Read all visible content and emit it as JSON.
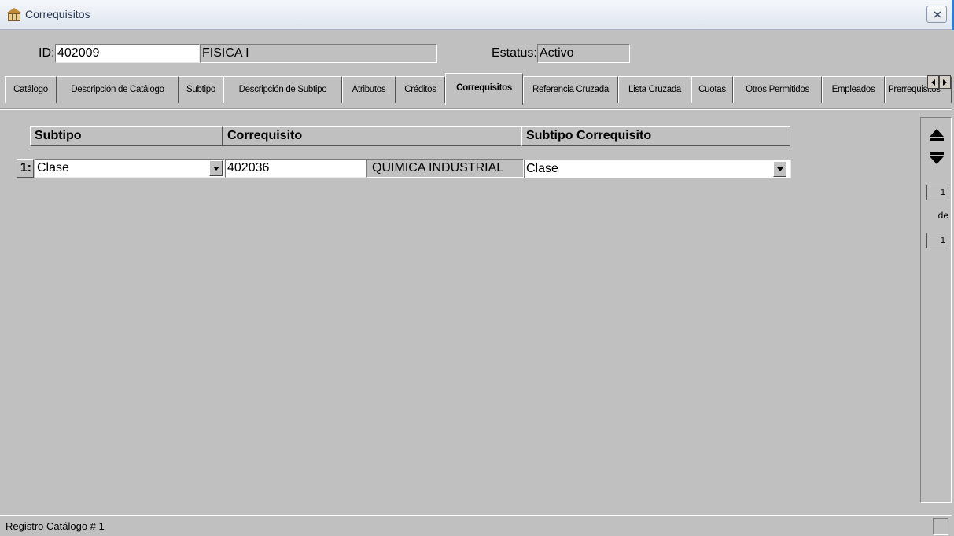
{
  "window": {
    "title": "Correquisitos",
    "colors": {
      "titlebar_text": "#2a3a55",
      "face": "#c0c0c0",
      "accent": "#2a7fd4"
    }
  },
  "header": {
    "id_label": "ID:",
    "id_value": "402009",
    "course_name": "FISICA I",
    "status_label": "Estatus:",
    "status_value": "Activo"
  },
  "tabs": [
    {
      "label": "Catálogo"
    },
    {
      "label": "Descripción de Catálogo"
    },
    {
      "label": "Subtipo"
    },
    {
      "label": "Descripción de Subtipo"
    },
    {
      "label": "Atributos"
    },
    {
      "label": "Créditos"
    },
    {
      "label": "Correquisitos"
    },
    {
      "label": "Referencia Cruzada"
    },
    {
      "label": "Lista Cruzada"
    },
    {
      "label": "Cuotas"
    },
    {
      "label": "Otros Permitidos"
    },
    {
      "label": "Empleados"
    },
    {
      "label": "Prerrequisitos"
    }
  ],
  "active_tab": "Correquisitos",
  "grid": {
    "headers": {
      "subtipo": "Subtipo",
      "correquisito": "Correquisito",
      "subtipo_correquisito": "Subtipo Correquisito"
    },
    "rows": [
      {
        "num": "1:",
        "subtipo": "Clase",
        "correquisito_id": "402036",
        "correquisito_name": "QUIMICA INDUSTRIAL",
        "subtipo_correquisito": "Clase"
      }
    ]
  },
  "navigator": {
    "current": "1",
    "of_label": "de",
    "total": "1"
  },
  "status": {
    "text": "Registro Catálogo # 1"
  },
  "icons": {
    "app": "app-icon",
    "close": "close-icon",
    "scroll_left": "scroll-left-icon",
    "scroll_right": "scroll-right-icon",
    "dropdown": "chevron-down-icon",
    "prev": "arrow-up-icon",
    "next": "arrow-down-icon"
  }
}
